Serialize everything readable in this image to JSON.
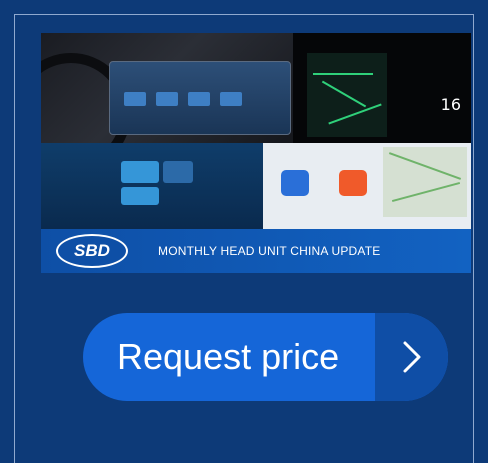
{
  "promo": {
    "logo_text": "SBD",
    "banner_text": "MONTHLY HEAD UNIT CHINA UPDATE",
    "screen_number": "16"
  },
  "cta": {
    "label": "Request price",
    "arrow_icon": "chevron-right-icon"
  },
  "colors": {
    "background": "#0d3a78",
    "button": "#1566d8",
    "button_arrow": "#0f4ea6",
    "banner": "#0e4fa6"
  }
}
